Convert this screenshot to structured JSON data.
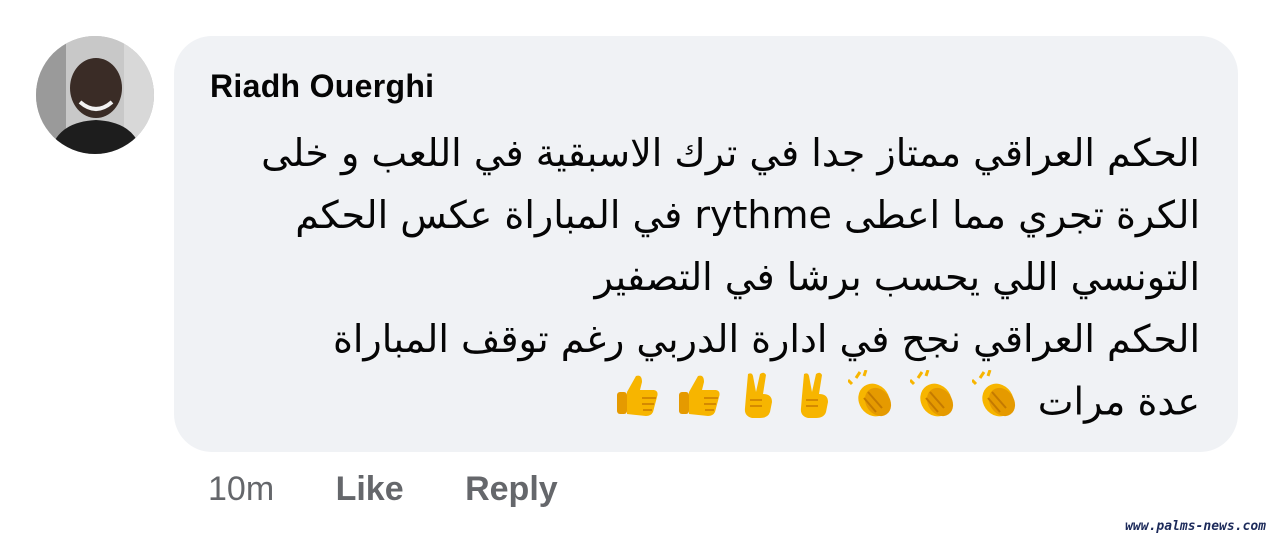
{
  "comment": {
    "author": "Riadh Ouerghi",
    "lines": [
      "الحكم العراقي ممتاز جدا في ترك الاسبقية في اللعب و خلى",
      "الكرة تجري مما اعطى rythme  في المباراة عكس الحكم",
      "التونسي اللي يحسب برشا في التصفير",
      " الحكم  العراقي نجح في ادارة الدربي رغم توقف المباراة",
      "عدة مرات"
    ],
    "emojis": [
      "clapping-hands",
      "clapping-hands",
      "clapping-hands",
      "victory-hand",
      "victory-hand",
      "thumbs-up",
      "thumbs-up"
    ]
  },
  "actions": {
    "timestamp": "10m",
    "like": "Like",
    "reply": "Reply"
  },
  "watermark": "www.palms-news.com",
  "colors": {
    "bubble": "#f0f2f5",
    "action_text": "#65676b",
    "emoji_yellow": "#f7b500"
  }
}
